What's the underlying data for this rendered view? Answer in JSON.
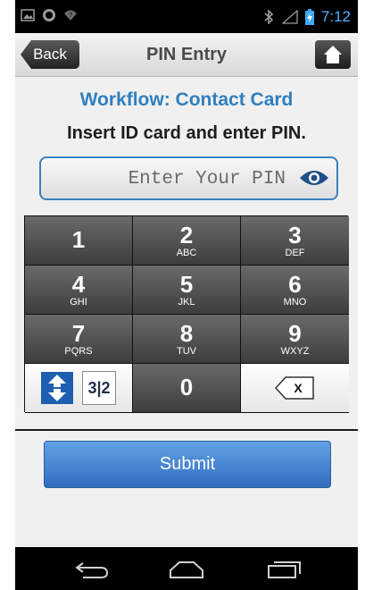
{
  "statusbar": {
    "time": "7:12",
    "icons": [
      "image-icon",
      "android-icon",
      "wifi-unknown-icon",
      "bluetooth-icon",
      "signal-icon",
      "battery-icon"
    ]
  },
  "titlebar": {
    "back_label": "Back",
    "title": "PIN Entry",
    "home_icon": "home-icon"
  },
  "workflow": "Workflow: Contact Card",
  "instruction": "Insert ID card and enter PIN.",
  "pin_input": {
    "value": "",
    "placeholder": "Enter Your PIN",
    "toggle_icon": "eye-icon"
  },
  "keypad": {
    "keys": [
      {
        "num": "1",
        "letters": ""
      },
      {
        "num": "2",
        "letters": "ABC"
      },
      {
        "num": "3",
        "letters": "DEF"
      },
      {
        "num": "4",
        "letters": "GHI"
      },
      {
        "num": "5",
        "letters": "JKL"
      },
      {
        "num": "6",
        "letters": "MNO"
      },
      {
        "num": "7",
        "letters": "PQRS"
      },
      {
        "num": "8",
        "letters": "TUV"
      },
      {
        "num": "9",
        "letters": "WXYZ"
      }
    ],
    "zero": "0",
    "symbols_label": "3|2",
    "delete_label": "X"
  },
  "submit_label": "Submit",
  "colors": {
    "accent": "#2f7fbf",
    "submit": "#4a88d4",
    "key_dark": "#4d4d4d"
  }
}
